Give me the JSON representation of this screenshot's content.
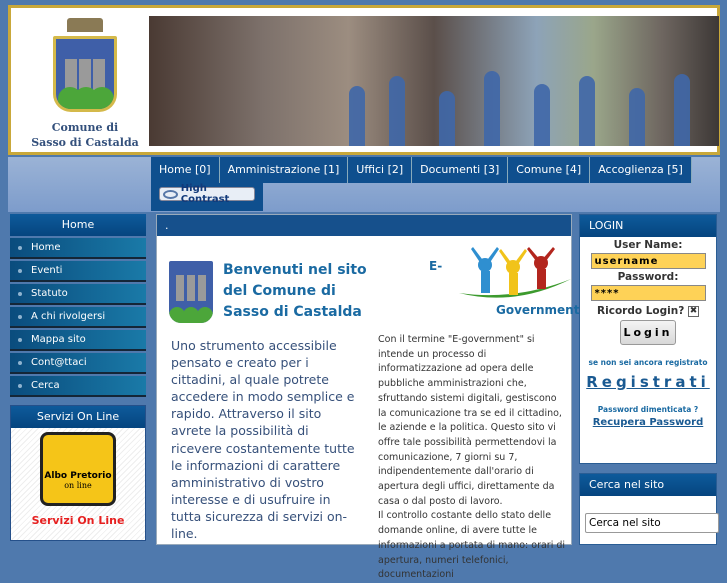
{
  "header": {
    "logo_line1": "Comune di",
    "logo_line2": "Sasso di Castalda"
  },
  "nav": {
    "tabs": [
      "Home [0]",
      "Amministrazione [1]",
      "Uffici [2]",
      "Documenti [3]",
      "Comune [4]",
      "Accoglienza [5]"
    ],
    "high_contrast": "High Contrast"
  },
  "sidebar": {
    "title": "Home",
    "items": [
      "Home",
      "Eventi",
      "Statuto",
      "A chi rivolgersi",
      "Mappa sito",
      "Cont@ttaci",
      "Cerca"
    ],
    "servizi_title": "Servizi On Line",
    "albo_line1": "Albo Pretorio",
    "albo_line2": "on line",
    "servizi_link": "Servizi On Line"
  },
  "content": {
    "title": ".",
    "welcome": "Benvenuti nel sito del Comune di Sasso di Castalda",
    "intro": "Uno strumento accessibile pensato e creato per i cittadini, al quale potrete accedere in modo semplice e rapido. Attraverso il sito avrete la possibilità di ricevere costantemente tutte le informazioni di carattere amministrativo di vostro interesse e di usufruire in tutta sicurezza di servizi on-line.",
    "eg_prefix": "E-",
    "eg_suffix": "Government",
    "eg_text1": "Con il termine \"E-government\" si intende un processo di informatizzazione ad opera delle pubbliche amministrazioni che, sfruttando sistemi digitali, gestiscono la comunicazione tra se ed il cittadino, le aziende e la politica. Questo sito vi offre tale possibilità permettendovi la comunicazione, 7 giorni su 7, indipendentemente dall'orario di apertura degli uffici, direttamente da casa o dal posto di lavoro.",
    "eg_text2": "Il controllo costante dello stato delle domande online, di avere tutte le informazioni a portata di mano: orari di apertura, numeri telefonici, documentazioni"
  },
  "login": {
    "title": "LOGIN",
    "username_label": "User Name:",
    "username_value": "username",
    "password_label": "Password:",
    "password_value": "****",
    "remember_label": "Ricordo Login?",
    "remember_mark": "✖",
    "button": "Login",
    "not_registered": "se non sei ancora registrato",
    "register": "Registrati",
    "forgot": "Password dimenticata ?",
    "recover": "Recupera Password"
  },
  "search": {
    "title": "Cerca nel sito",
    "value": "Cerca nel sito"
  },
  "colors": {
    "nav": "#0f4f8e",
    "accent": "#1a6aa2",
    "input": "#fed257",
    "servizi": "#e62020"
  }
}
